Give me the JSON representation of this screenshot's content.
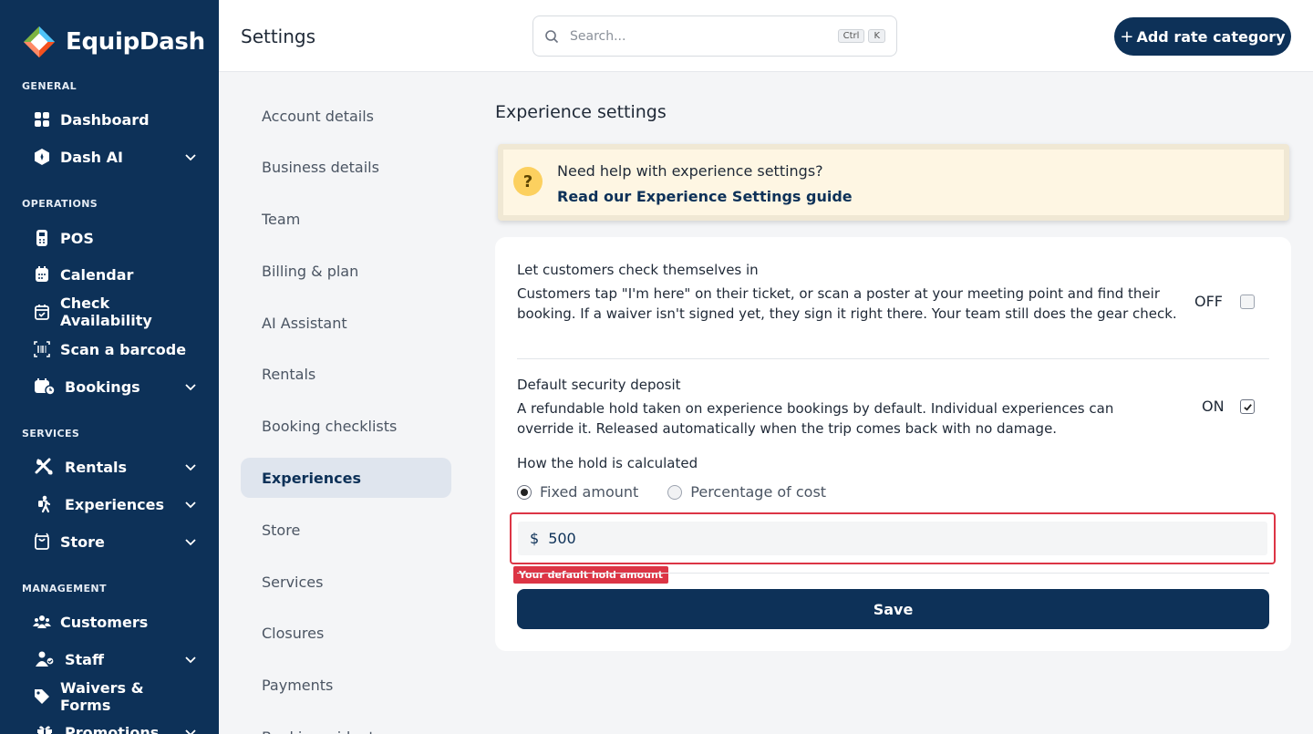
{
  "app": {
    "name": "EquipDash"
  },
  "sidebar": {
    "sections": [
      {
        "label": "GENERAL"
      },
      {
        "label": "OPERATIONS"
      },
      {
        "label": "SERVICES"
      },
      {
        "label": "MANAGEMENT"
      }
    ],
    "items": [
      {
        "label": "Dashboard",
        "icon": "grid-icon"
      },
      {
        "label": "Dash AI",
        "icon": "ai-icon",
        "expandable": true
      },
      {
        "label": "POS",
        "icon": "pos-icon"
      },
      {
        "label": "Calendar",
        "icon": "calendar-icon"
      },
      {
        "label": "Check Availability",
        "icon": "calendar-check-icon"
      },
      {
        "label": "Scan a barcode",
        "icon": "barcode-icon"
      },
      {
        "label": "Bookings",
        "icon": "bookings-icon",
        "expandable": true
      },
      {
        "label": "Rentals",
        "icon": "rentals-icon",
        "expandable": true
      },
      {
        "label": "Experiences",
        "icon": "hiker-icon",
        "expandable": true
      },
      {
        "label": "Store",
        "icon": "store-icon",
        "expandable": true
      },
      {
        "label": "Customers",
        "icon": "customers-icon"
      },
      {
        "label": "Staff",
        "icon": "staff-icon",
        "expandable": true
      },
      {
        "label": "Waivers & Forms",
        "icon": "tag-icon"
      },
      {
        "label": "Promotions",
        "icon": "gift-icon",
        "expandable": true
      }
    ]
  },
  "header": {
    "title": "Settings",
    "search": {
      "placeholder": "Search...",
      "shortcut": [
        "Ctrl",
        "K"
      ]
    },
    "add_button": {
      "plus": "+",
      "label": "Add rate category"
    }
  },
  "settings_menu": {
    "active": "Experiences",
    "items": [
      "Account details",
      "Business details",
      "Team",
      "Billing & plan",
      "AI Assistant",
      "Rentals",
      "Booking checklists",
      "Experiences",
      "Store",
      "Services",
      "Closures",
      "Payments",
      "Booking widget"
    ]
  },
  "experience": {
    "title": "Experience settings",
    "help": {
      "icon": "?",
      "question": "Need help with experience settings?",
      "link": "Read our Experience Settings guide"
    },
    "self_checkin": {
      "title": "Let customers check themselves in",
      "description": "Customers tap \"I'm here\" on their ticket, or scan a poster at your meeting point and find their booking. If a waiver isn't signed yet, they sign it right there. Your team still does the gear check.",
      "state": "OFF",
      "checked": false
    },
    "deposit": {
      "title": "Default security deposit",
      "description": "A refundable hold taken on experience bookings by default. Individual experiences can override it. Released automatically when the trip comes back with no damage.",
      "state": "ON",
      "checked": true,
      "calc_label": "How the hold is calculated",
      "options": [
        "Fixed amount",
        "Percentage of cost"
      ],
      "selected": "Fixed amount",
      "currency": "$",
      "amount": "500",
      "tooltip": "Your default hold amount"
    },
    "save_label": "Save"
  },
  "colors": {
    "brand": "#0d3158",
    "error": "#dc3545",
    "help_bg": "#fef6e3"
  }
}
